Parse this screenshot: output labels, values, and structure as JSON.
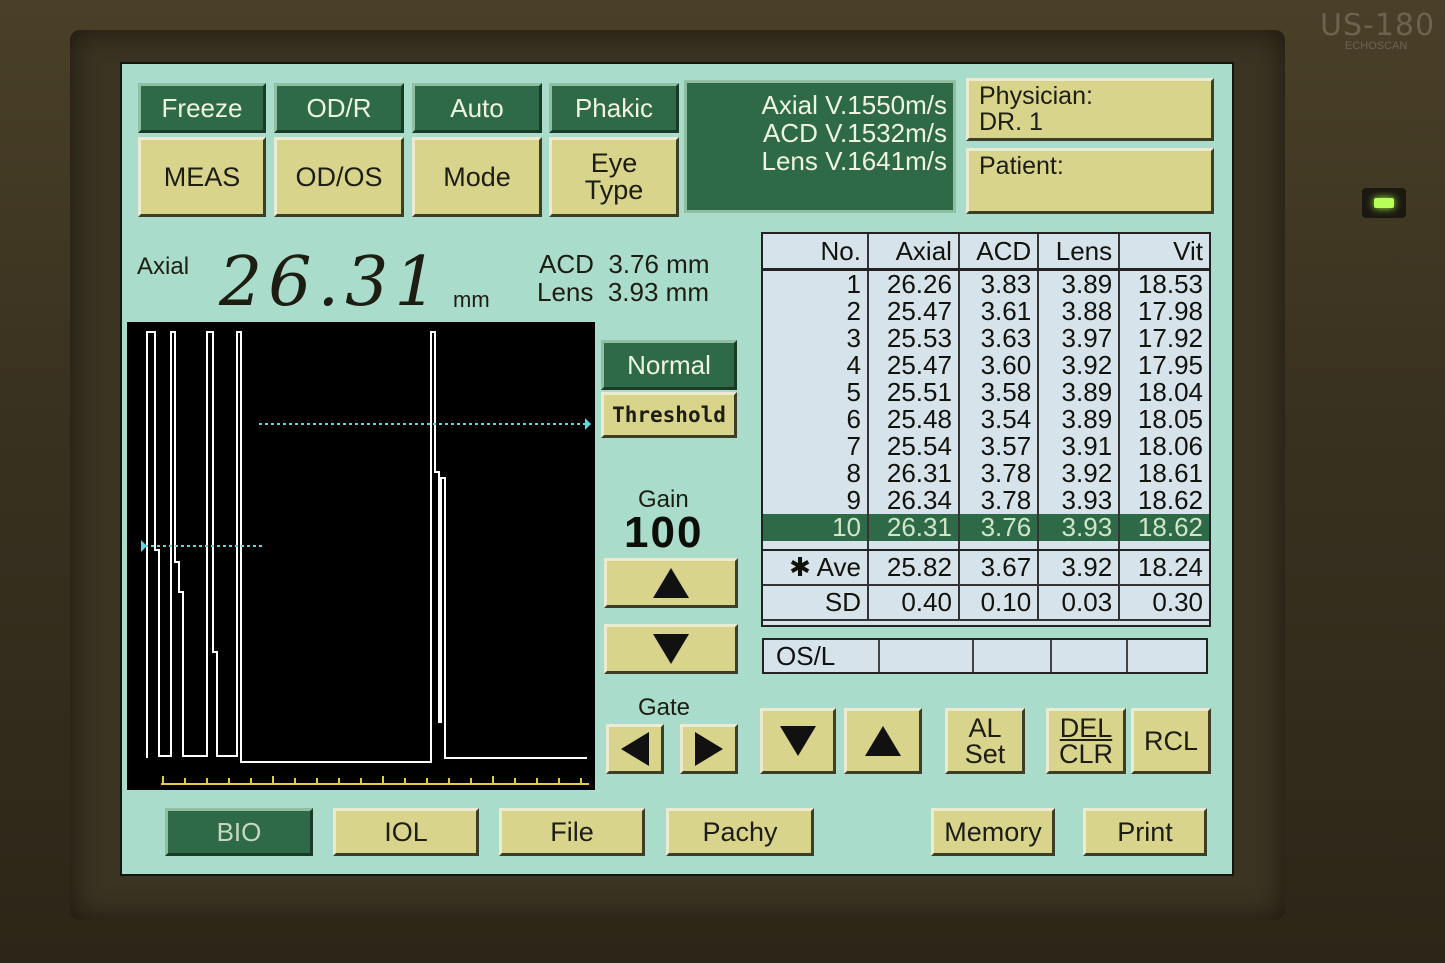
{
  "device": {
    "brand": "US-180",
    "brand_sub": "ECHOSCAN"
  },
  "top_buttons": {
    "freeze": "Freeze",
    "od_r": "OD/R",
    "auto": "Auto",
    "phakic": "Phakic",
    "meas": "MEAS",
    "od_os": "OD/OS",
    "mode": "Mode",
    "eye_type_line1": "Eye",
    "eye_type_line2": "Type"
  },
  "velocity": {
    "axial": "Axial V.1550m/s",
    "acd": "ACD V.1532m/s",
    "lens": "Lens V.1641m/s"
  },
  "physician": {
    "label": "Physician:",
    "value": "DR. 1"
  },
  "patient": {
    "label": "Patient:",
    "value": ""
  },
  "measurement": {
    "axial_label": "Axial",
    "axial_value": "26.31",
    "axial_unit": "mm",
    "acd_label": "ACD",
    "acd_value": "3.76 mm",
    "lens_label": "Lens",
    "lens_value": "3.93 mm"
  },
  "side_controls": {
    "normal": "Normal",
    "threshold": "Threshold",
    "gain_label": "Gain",
    "gain_value": "100",
    "gate_label": "Gate"
  },
  "table": {
    "headers": [
      "No.",
      "Axial",
      "ACD",
      "Lens",
      "Vit"
    ],
    "rows": [
      [
        "1",
        "26.26",
        "3.83",
        "3.89",
        "18.53"
      ],
      [
        "2",
        "25.47",
        "3.61",
        "3.88",
        "17.98"
      ],
      [
        "3",
        "25.53",
        "3.63",
        "3.97",
        "17.92"
      ],
      [
        "4",
        "25.47",
        "3.60",
        "3.92",
        "17.95"
      ],
      [
        "5",
        "25.51",
        "3.58",
        "3.89",
        "18.04"
      ],
      [
        "6",
        "25.48",
        "3.54",
        "3.89",
        "18.05"
      ],
      [
        "7",
        "25.54",
        "3.57",
        "3.91",
        "18.06"
      ],
      [
        "8",
        "26.31",
        "3.78",
        "3.92",
        "18.61"
      ],
      [
        "9",
        "26.34",
        "3.78",
        "3.93",
        "18.62"
      ],
      [
        "10",
        "26.31",
        "3.76",
        "3.93",
        "18.62"
      ]
    ],
    "selected_row": 10,
    "ave": [
      "✱ Ave",
      "25.82",
      "3.67",
      "3.92",
      "18.24"
    ],
    "sd": [
      "SD",
      "0.40",
      "0.10",
      "0.03",
      "0.30"
    ],
    "eye": "OS/L"
  },
  "right_controls": {
    "al_set_line1": "AL",
    "al_set_line2": "Set",
    "del_clr_line1": "DEL",
    "del_clr_line2": "CLR",
    "rcl": "RCL"
  },
  "bottom_tabs": {
    "bio": "BIO",
    "iol": "IOL",
    "file": "File",
    "pachy": "Pachy",
    "memory": "Memory",
    "print": "Print"
  },
  "colors": {
    "screen_bg": "#a9dccb",
    "button_yellow": "#d8d48c",
    "button_green": "#2e6a48",
    "selected_row": "#2e6a48",
    "scope_trace": "#ffffff",
    "gate_cyan": "#5fd6e0",
    "scale_yellow": "#e0d040"
  }
}
